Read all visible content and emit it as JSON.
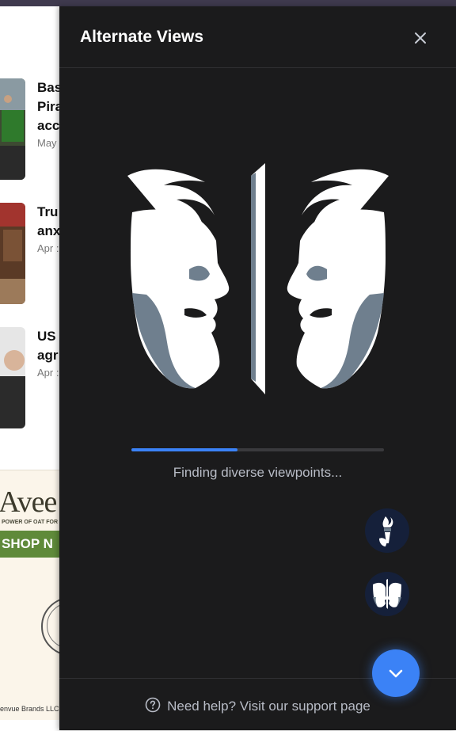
{
  "panel": {
    "title": "Alternate Views",
    "status_text": "Finding diverse viewpoints...",
    "progress": 0.42,
    "help_text": "Need help? Visit our support page",
    "accent_color": "#3b82f6",
    "icons": [
      "close-icon",
      "torch-icon",
      "faces-icon",
      "chevron-down-icon",
      "help-icon"
    ]
  },
  "background_page": {
    "articles": [
      {
        "title": "Bas\nPira\nacc",
        "date": "May"
      },
      {
        "title": "Tru\nanx",
        "date": "Apr :"
      },
      {
        "title": "US\nagr",
        "date": "Apr :"
      }
    ],
    "ad": {
      "brand": "Avee",
      "tagline": "POWER OF OAT FOR",
      "cta": "SHOP N",
      "legal": "envue Brands LLC"
    }
  }
}
